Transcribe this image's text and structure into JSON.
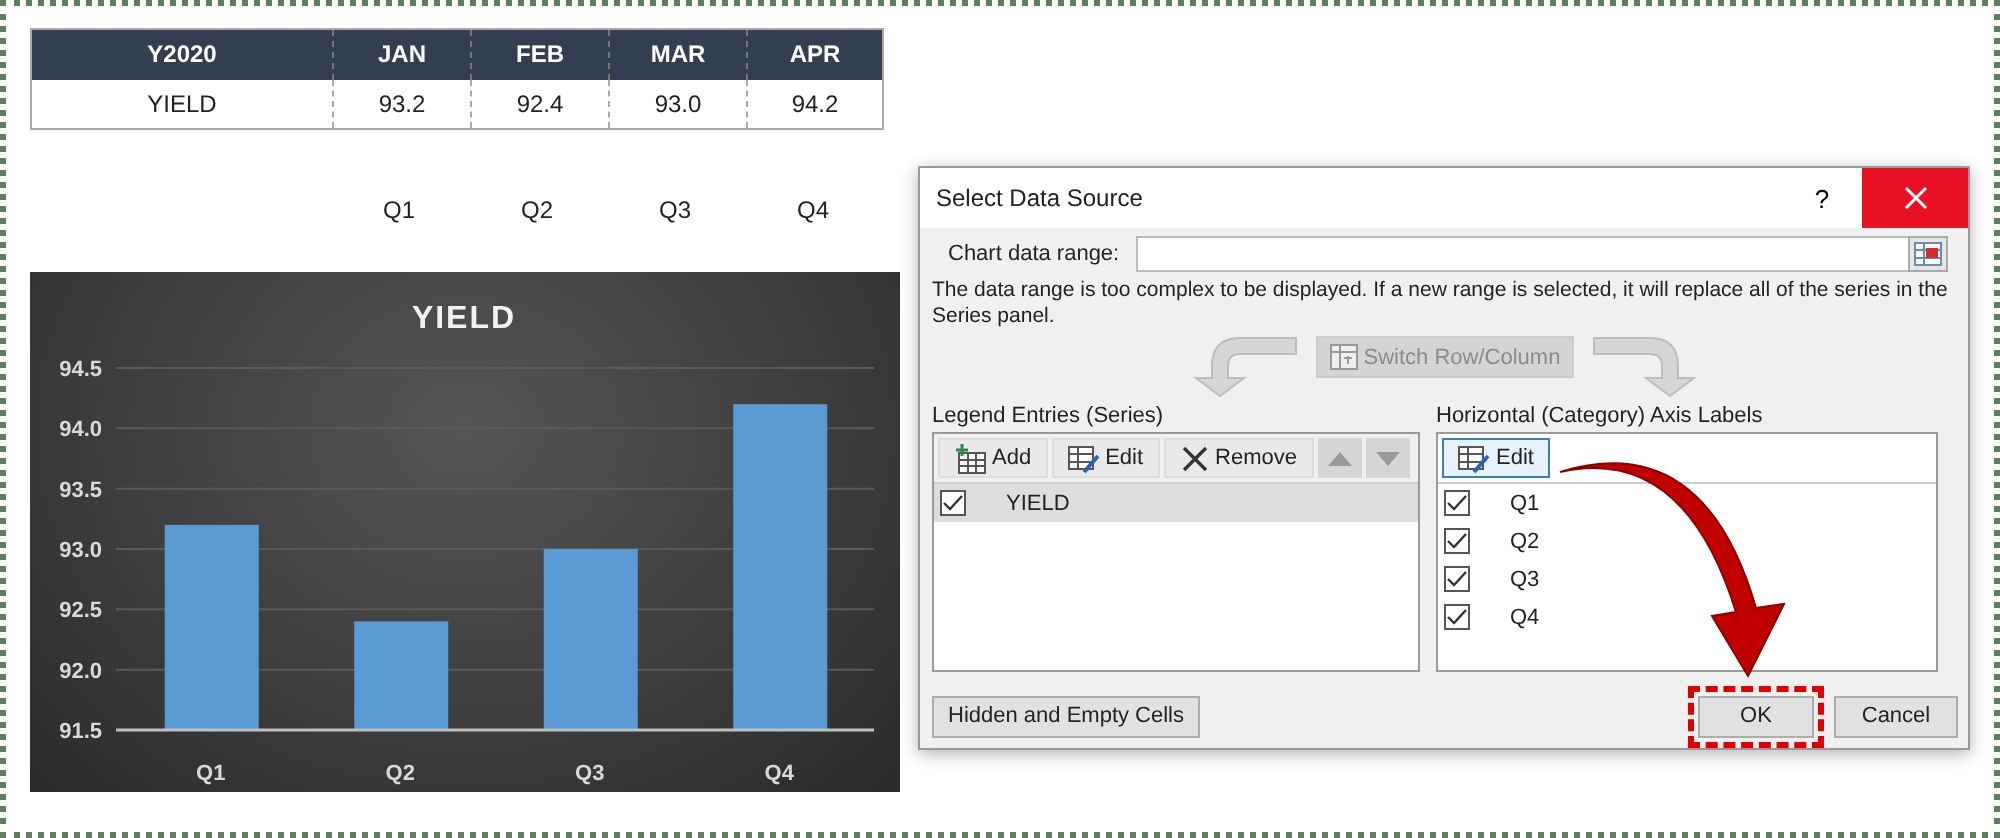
{
  "table": {
    "columns": [
      "Y2020",
      "JAN",
      "FEB",
      "MAR",
      "APR"
    ],
    "rows": [
      [
        "YIELD",
        "93.2",
        "92.4",
        "93.0",
        "94.2"
      ]
    ]
  },
  "quarter_labels": [
    "Q1",
    "Q2",
    "Q3",
    "Q4"
  ],
  "chart": {
    "chart_data": {
      "type": "bar",
      "title": "YIELD",
      "categories": [
        "Q1",
        "Q2",
        "Q3",
        "Q4"
      ],
      "series": [
        {
          "color": "#5b9bd5",
          "values": [
            93.2,
            92.4,
            93.0,
            94.2
          ]
        }
      ],
      "grid": true,
      "ylim": [
        91.5,
        94.5
      ],
      "yticks": [
        {
          "value": 91.5,
          "label": "91.5"
        },
        {
          "value": 92,
          "label": "92.0"
        },
        {
          "value": 92.5,
          "label": "92.5"
        },
        {
          "value": 93,
          "label": "93.0"
        },
        {
          "value": 93.5,
          "label": "93.5"
        },
        {
          "value": 94,
          "label": "94.0"
        },
        {
          "value": 94.5,
          "label": "94.5"
        }
      ]
    }
  },
  "dialog": {
    "title": "Select Data Source",
    "help": "?",
    "range_label": "Chart data range:",
    "message": "The data range is too complex to be displayed. If a new range is selected, it will replace all of the series in the Series panel.",
    "switch_button": {
      "label": "Switch Row/Column",
      "disabled": true
    },
    "legend": {
      "label": "Legend Entries (Series)",
      "buttons": [
        {
          "kind": "add",
          "label": "Add",
          "disabled": false
        },
        {
          "kind": "edit",
          "label": "Edit",
          "disabled": false
        },
        {
          "kind": "remove",
          "label": "Remove",
          "disabled": false
        },
        {
          "kind": "up",
          "disabled": true
        },
        {
          "kind": "down",
          "disabled": true
        }
      ],
      "entries": [
        {
          "label": "YIELD",
          "checked": true,
          "selected": true
        }
      ]
    },
    "axis": {
      "label": "Horizontal (Category) Axis Labels",
      "edit_button": "Edit",
      "items": [
        {
          "label": "Q1",
          "checked": true
        },
        {
          "label": "Q2",
          "checked": true
        },
        {
          "label": "Q3",
          "checked": true
        },
        {
          "label": "Q4",
          "checked": true
        }
      ]
    },
    "hidden_button": "Hidden and Empty Cells",
    "ok_button": {
      "label": "OK",
      "highlighted": true
    },
    "cancel_button": "Cancel"
  }
}
